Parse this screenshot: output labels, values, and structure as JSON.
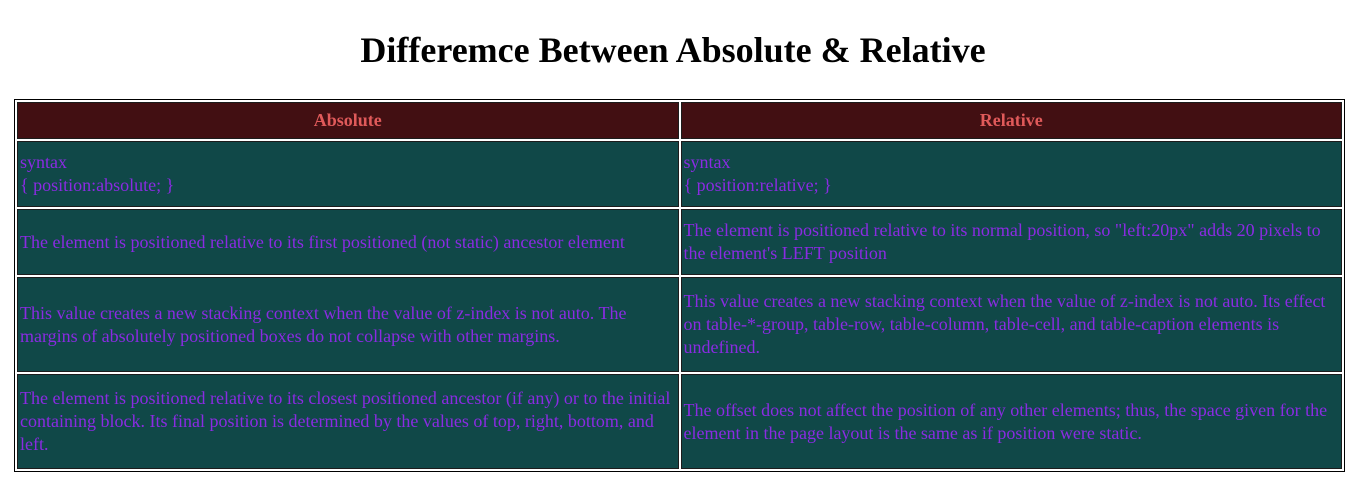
{
  "page": {
    "title": "Differemce Between Absolute & Relative"
  },
  "table": {
    "headers": [
      "Absolute",
      "Relative"
    ],
    "rows": [
      {
        "absolute": [
          "syntax",
          "{ position:absolute; }"
        ],
        "relative": [
          "syntax",
          "{ position:relative; }"
        ]
      },
      {
        "absolute": [
          "The element is positioned relative to its first positioned (not static) ancestor element"
        ],
        "relative": [
          "The element is positioned relative to its normal position, so \"left:20px\" adds 20 pixels to the element's LEFT position"
        ]
      },
      {
        "absolute": [
          "This value creates a new stacking context when the value of z-index is not auto. The margins of absolutely positioned boxes do not collapse with other margins."
        ],
        "relative": [
          "This value creates a new stacking context when the value of z-index is not auto. Its effect on table-*-group, table-row, table-column, table-cell, and table-caption elements is undefined."
        ]
      },
      {
        "absolute": [
          "The element is positioned relative to its closest positioned ancestor (if any) or to the initial containing block. Its final position is determined by the values of top, right, bottom, and left."
        ],
        "relative": [
          "The offset does not affect the position of any other elements; thus, the space given for the element in the page layout is the same as if position were static."
        ]
      }
    ]
  },
  "colors": {
    "header_bg": "#420f12",
    "header_text": "#e05a5a",
    "cell_bg": "#104848",
    "cell_text": "#8a2be2"
  }
}
